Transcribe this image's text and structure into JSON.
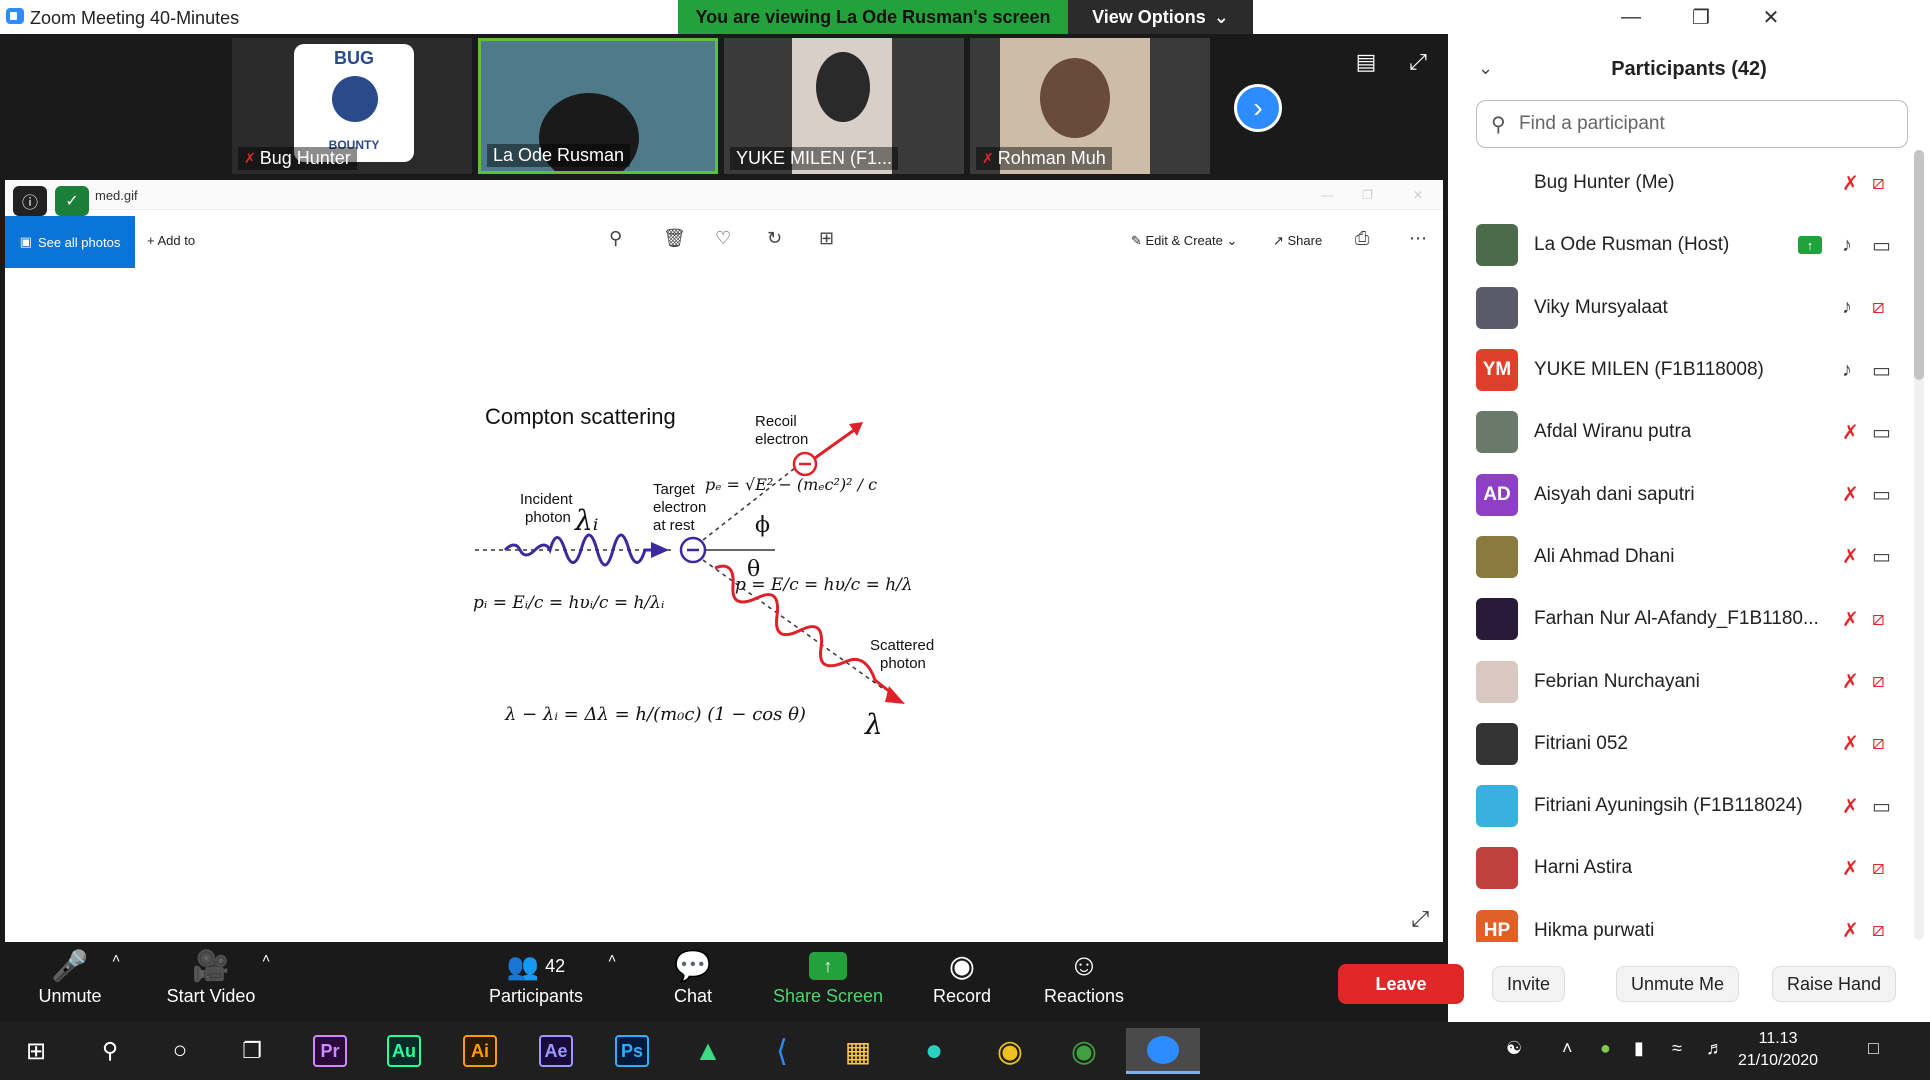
{
  "window": {
    "title": "Zoom Meeting 40-Minutes",
    "banner": "You are viewing La Ode Rusman's screen",
    "view_options": "View Options"
  },
  "thumbnails": [
    {
      "name": "Bug Hunter",
      "muted": true
    },
    {
      "name": "La Ode Rusman",
      "muted": false
    },
    {
      "name": "YUKE MILEN (F1...",
      "muted": false
    },
    {
      "name": "Rohman Muh",
      "muted": true
    }
  ],
  "logo_text": {
    "bug": "BUG",
    "bounty": "BOUNTY"
  },
  "shared_screen": {
    "file_title": "med.gif",
    "see_all_photos": "See all photos",
    "add_to": "Add to",
    "edit_create": "Edit & Create",
    "share": "Share"
  },
  "diagram": {
    "title": "Compton scattering",
    "recoil": "Recoil",
    "electron": "electron",
    "incident": "Incident",
    "photon": "photon",
    "target": "Target",
    "target_electron": "electron",
    "at_rest": "at rest",
    "scattered": "Scattered",
    "scattered_photon": "photon"
  },
  "toolbar": {
    "unmute": "Unmute",
    "start_video": "Start Video",
    "participants": "Participants",
    "participants_count": "42",
    "chat": "Chat",
    "share_screen": "Share Screen",
    "record": "Record",
    "reactions": "Reactions",
    "leave": "Leave"
  },
  "panel": {
    "title": "Participants (42)",
    "search_placeholder": "Find a participant",
    "invite": "Invite",
    "unmute_me": "Unmute Me",
    "raise_hand": "Raise Hand"
  },
  "participants": [
    {
      "name": "Bug Hunter (Me)",
      "initials": "",
      "color": "#ffffff",
      "mic_off": true,
      "cam_off": true
    },
    {
      "name": "La Ode Rusman (Host)",
      "initials": "",
      "color": "#4b6b4b",
      "mic_off": false,
      "cam_off": false,
      "sharing": true
    },
    {
      "name": "Viky Mursyalaat",
      "initials": "",
      "color": "#5a5a6a",
      "mic_off": false,
      "cam_off": true
    },
    {
      "name": "YUKE MILEN (F1B118008)",
      "initials": "YM",
      "color": "#e0402a",
      "mic_off": false,
      "cam_off": false
    },
    {
      "name": "Afdal Wiranu putra",
      "initials": "",
      "color": "#6a7a6a",
      "mic_off": true,
      "cam_off": false
    },
    {
      "name": "Aisyah dani saputri",
      "initials": "AD",
      "color": "#8e3fc4",
      "mic_off": true,
      "cam_off": false
    },
    {
      "name": "Ali Ahmad Dhani",
      "initials": "",
      "color": "#8a7a40",
      "mic_off": true,
      "cam_off": false
    },
    {
      "name": "Farhan Nur Al-Afandy_F1B1180...",
      "initials": "",
      "color": "#2a1a3a",
      "mic_off": true,
      "cam_off": true
    },
    {
      "name": "Febrian Nurchayani",
      "initials": "",
      "color": "#d8c8c0",
      "mic_off": true,
      "cam_off": true
    },
    {
      "name": "Fitriani 052",
      "initials": "",
      "color": "#333333",
      "mic_off": true,
      "cam_off": true
    },
    {
      "name": "Fitriani Ayuningsih (F1B118024)",
      "initials": "",
      "color": "#3ab0e0",
      "mic_off": true,
      "cam_off": false
    },
    {
      "name": "Harni Astira",
      "initials": "",
      "color": "#c04040",
      "mic_off": true,
      "cam_off": true
    },
    {
      "name": "Hikma purwati",
      "initials": "HP",
      "color": "#e0602a",
      "mic_off": true,
      "cam_off": true
    }
  ],
  "taskbar": {
    "apps": [
      "Pr",
      "Au",
      "Ai",
      "Ae",
      "Ps"
    ],
    "time": "11.13",
    "date": "21/10/2020"
  },
  "colors": {
    "accent": "#2d8cff",
    "banner_green": "#23a23b",
    "leave_red": "#e02828"
  }
}
